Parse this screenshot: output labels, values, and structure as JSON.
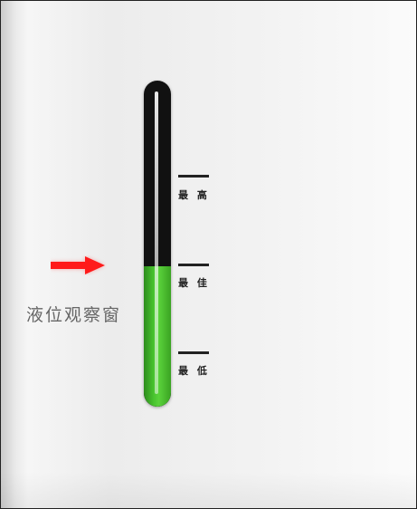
{
  "window_label": "液位观察窗",
  "level": {
    "fraction": 0.43
  },
  "markers": {
    "high": "最 高",
    "best": "最 佳",
    "low": "最 低"
  },
  "colors": {
    "fluid": "#47c22e",
    "tube": "#111111",
    "arrow": "#ff1a1a"
  },
  "icons": {
    "arrow": "arrow-right-icon"
  }
}
